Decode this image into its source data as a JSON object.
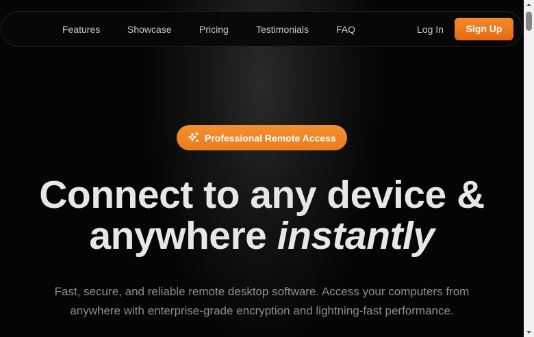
{
  "nav": {
    "links": [
      "Features",
      "Showcase",
      "Pricing",
      "Testimonials",
      "FAQ"
    ],
    "login_label": "Log In",
    "signup_label": "Sign Up"
  },
  "hero": {
    "badge_icon": "sparkle-icon",
    "badge_label": "Professional Remote Access",
    "title_line1": "Connect to any device &",
    "title_line2_plain": "anywhere",
    "title_line2_italic": "instantly",
    "subtitle_line1": "Fast, secure, and reliable remote desktop software. Access your computers from",
    "subtitle_line2": "anywhere with enterprise-grade encryption and lightning-fast performance."
  },
  "colors": {
    "accent": "#ea7c1e",
    "background": "#050505",
    "title_text": "#e7e7e7",
    "muted_text": "#8d8d8d"
  },
  "scrollbar": {
    "up_icon": "scroll-up-arrow-icon",
    "down_icon": "scroll-down-arrow-icon"
  }
}
